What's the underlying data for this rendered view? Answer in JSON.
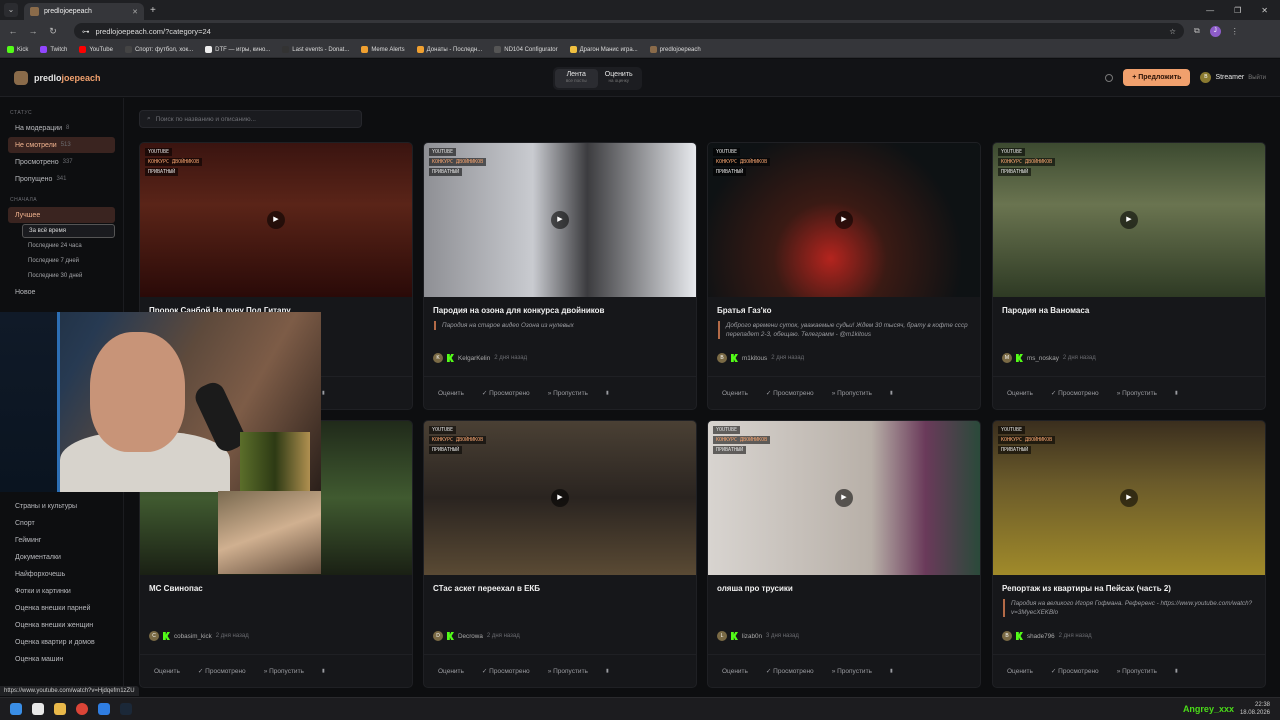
{
  "browser": {
    "tab_title": "predlojoepeach",
    "url": "predlojoepeach.com/?category=24",
    "bookmarks": [
      "Kick",
      "Twitch",
      "YouTube",
      "Спорт: футбол, хок...",
      "DTF — игры, кино...",
      "Last events - Donat...",
      "Meme Alerts",
      "Донаты - Последн...",
      "ND104 Configurator",
      "Драгон Манис игра...",
      "predlojoepeach"
    ],
    "bookmark_colors": [
      "#53fc18",
      "#9146ff",
      "#ff0000",
      "#444",
      "#eee",
      "#333",
      "#f0a030",
      "#f0a030",
      "#555",
      "#f0c040",
      "#8a6b4a"
    ],
    "profile_initial": "J"
  },
  "header": {
    "brand_a": "predlo",
    "brand_b": "joepeach",
    "nav": [
      {
        "label": "Лента",
        "sub": "все посты"
      },
      {
        "label": "Оценить",
        "sub": "на оценку"
      }
    ],
    "suggest_button": "+ Предложить",
    "user_initial": "B",
    "user_name": "Streamer",
    "logout": "Выйти"
  },
  "sidebar": {
    "status_title": "СТАТУС",
    "status_items": [
      {
        "label": "На модерации",
        "count": "8"
      },
      {
        "label": "Не смотрели",
        "count": "513"
      },
      {
        "label": "Просмотрено",
        "count": "337"
      },
      {
        "label": "Пропущено",
        "count": "341"
      }
    ],
    "sort_title": "СНАЧАЛА",
    "sort_best": "Лучшее",
    "periods": [
      "За всё время",
      "Последние 24 часа",
      "Последние 7 дней",
      "Последние 30 дней"
    ],
    "sort_new": "Новое",
    "categories": [
      "Страны и культуры",
      "Спорт",
      "Гейминг",
      "Документалки",
      "Найфорхочешь",
      "Фотки и картинки",
      "Оценка внешки парней",
      "Оценка внешки женщин",
      "Оценка квартир и домов",
      "Оценка машин"
    ]
  },
  "search": {
    "placeholder": "Поиск по названию и описанию..."
  },
  "labels": {
    "source": "YOUTUBE",
    "contest": "КОНКУРС ДВОЙНИКОВ",
    "private": "ПРИВАТНЫЙ",
    "rate": "Оценить",
    "watched": "Просмотрено",
    "skip": "Пропустить"
  },
  "cards": [
    {
      "title": "Пророк Санбой На луну Под Гитару",
      "desc": "",
      "author": "",
      "initial": "",
      "time": "",
      "contest": true
    },
    {
      "title": "Пародия на озона для конкурса двойников",
      "desc": "Пародия на старое видео Озона из нулевых",
      "author": "KelgarKelin",
      "initial": "K",
      "time": "2 дня назад",
      "contest": true
    },
    {
      "title": "Братья Газ'ко",
      "desc": "Доброго времени суток, уважаемые судьи! Ждем 30 тысяч, брату в кофте ссср перепадет 2-3, обещаю. Телеграмм - @m1kitous",
      "author": "m1kitous",
      "initial": "B",
      "time": "2 дня назад",
      "contest": true
    },
    {
      "title": "Пародия на Ваномаса",
      "desc": "",
      "author": "ms_noskay",
      "initial": "M",
      "time": "2 дня назад",
      "contest": true
    },
    {
      "title": "МС Свинопас",
      "desc": "",
      "author": "cobasim_kick",
      "initial": "C",
      "time": "2 дня назад",
      "contest": false
    },
    {
      "title": "СТас аскет переехал в ЕКБ",
      "desc": "",
      "author": "Decrowa",
      "initial": "D",
      "time": "2 дня назад",
      "contest": true
    },
    {
      "title": "оляша про трусики",
      "desc": "",
      "author": "lizab0n",
      "initial": "L",
      "time": "3 дня назад",
      "contest": true
    },
    {
      "title": "Репортаж из квартиры на Пейсах (часть 2)",
      "desc": "Пародия на великого Игоря Гофмана. Референс - https://www.youtube.com/watch?v=3MyecXEKBlo",
      "author": "shade796",
      "initial": "B",
      "time": "2 дня назад",
      "contest": true
    }
  ],
  "status_url": "https://www.youtube.com/watch?v=Hjdqefm1zZU",
  "tray": {
    "watermark": "Angrey_xxx",
    "time": "22:38",
    "date": "18.08.2026"
  }
}
